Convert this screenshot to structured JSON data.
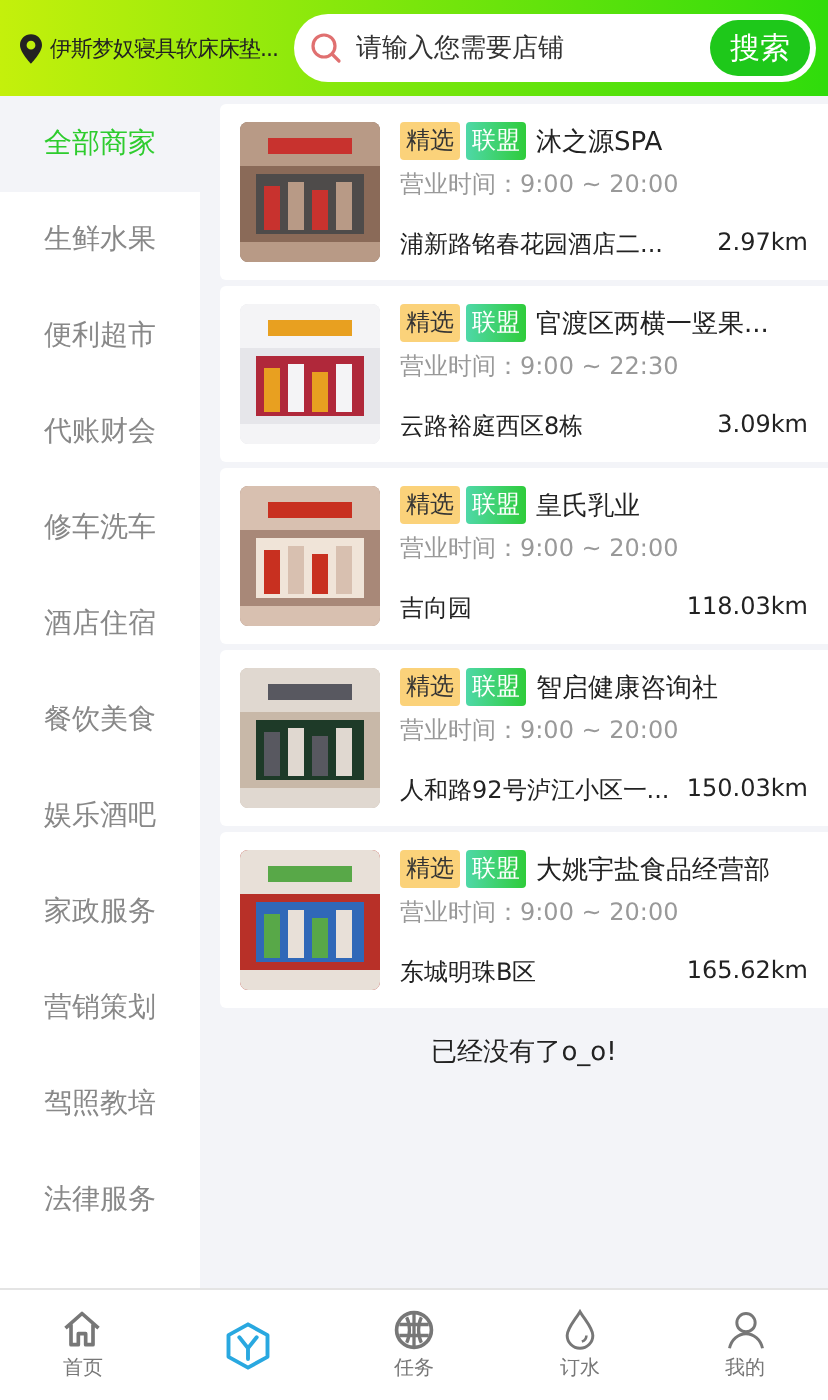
{
  "header": {
    "location": "伊斯梦奴寝具软床床垫...",
    "search": {
      "placeholder": "请输入您需要店铺"
    },
    "search_button": "搜索"
  },
  "sidebar": {
    "items": [
      {
        "label": "全部商家",
        "selected": true
      },
      {
        "label": "生鲜水果",
        "selected": false
      },
      {
        "label": "便利超市",
        "selected": false
      },
      {
        "label": "代账财会",
        "selected": false
      },
      {
        "label": "修车洗车",
        "selected": false
      },
      {
        "label": "酒店住宿",
        "selected": false
      },
      {
        "label": "餐饮美食",
        "selected": false
      },
      {
        "label": "娱乐酒吧",
        "selected": false
      },
      {
        "label": "家政服务",
        "selected": false
      },
      {
        "label": "营销策划",
        "selected": false
      },
      {
        "label": "驾照教培",
        "selected": false
      },
      {
        "label": "法律服务",
        "selected": false
      }
    ]
  },
  "shops": [
    {
      "tags": [
        {
          "kind": "featured",
          "text": "精选"
        },
        {
          "kind": "alliance",
          "text": "联盟"
        }
      ],
      "name": "沐之源SPA",
      "hours": "营业时间：9:00 ~ 20:00",
      "address": "浦新路铭春花园酒店二...",
      "distance": "2.97km"
    },
    {
      "tags": [
        {
          "kind": "featured",
          "text": "精选"
        },
        {
          "kind": "alliance",
          "text": "联盟"
        }
      ],
      "name": "官渡区两横一竖果...",
      "hours": "营业时间：9:00 ~ 22:30",
      "address": "云路裕庭西区8栋",
      "distance": "3.09km"
    },
    {
      "tags": [
        {
          "kind": "featured",
          "text": "精选"
        },
        {
          "kind": "alliance",
          "text": "联盟"
        }
      ],
      "name": "皇氏乳业",
      "hours": "营业时间：9:00 ~ 20:00",
      "address": "吉向园",
      "distance": "118.03km"
    },
    {
      "tags": [
        {
          "kind": "featured",
          "text": "精选"
        },
        {
          "kind": "alliance",
          "text": "联盟"
        }
      ],
      "name": "智启健康咨询社",
      "hours": "营业时间：9:00 ~ 20:00",
      "address": "人和路92号泸江小区一...",
      "distance": "150.03km"
    },
    {
      "tags": [
        {
          "kind": "featured",
          "text": "精选"
        },
        {
          "kind": "alliance",
          "text": "联盟"
        }
      ],
      "name": "大姚宇盐食品经营部",
      "hours": "营业时间：9:00 ~ 20:00",
      "address": "东城明珠B区",
      "distance": "165.62km"
    }
  ],
  "end_note": "已经没有了o_o!",
  "tab_bar": [
    {
      "kind": "home",
      "label": "首页",
      "selected": false
    },
    {
      "kind": "hexagon",
      "selected": true
    },
    {
      "kind": "task",
      "label": "任务",
      "selected": false
    },
    {
      "kind": "water",
      "label": "订水",
      "selected": false
    },
    {
      "kind": "profile",
      "label": "我的",
      "selected": false
    }
  ]
}
